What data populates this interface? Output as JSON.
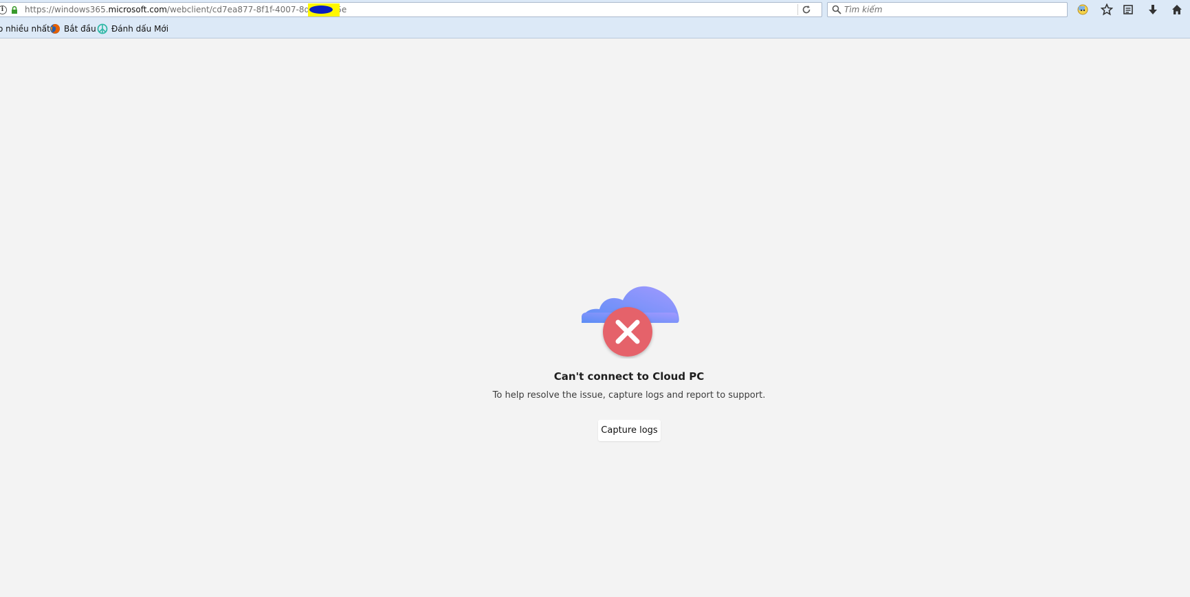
{
  "browser": {
    "url": {
      "prefix": "https://windows365.",
      "domain": "microsoft.com",
      "path": "/webclient/cd7ea877-8f1f-4007-8df5-7915e"
    },
    "search": {
      "placeholder": "Tìm kiếm"
    },
    "toolbar_icons": [
      "reload-icon",
      "extension-icon",
      "bookmark-star-icon",
      "reading-list-icon",
      "download-icon",
      "home-icon"
    ],
    "bookmarks": [
      {
        "label": "o nhiều nhất",
        "icon": "none"
      },
      {
        "label": "Bắt đầu",
        "icon": "firefox-icon"
      },
      {
        "label": "Đánh dấu Mới",
        "icon": "peace-icon"
      }
    ]
  },
  "error": {
    "title": "Can't connect to Cloud PC",
    "description": "To help resolve the issue, capture logs and report to support.",
    "button_label": "Capture logs",
    "colors": {
      "cloud_start": "#5b8df5",
      "cloud_end": "#9b97ff",
      "badge": "#e5626a"
    }
  }
}
